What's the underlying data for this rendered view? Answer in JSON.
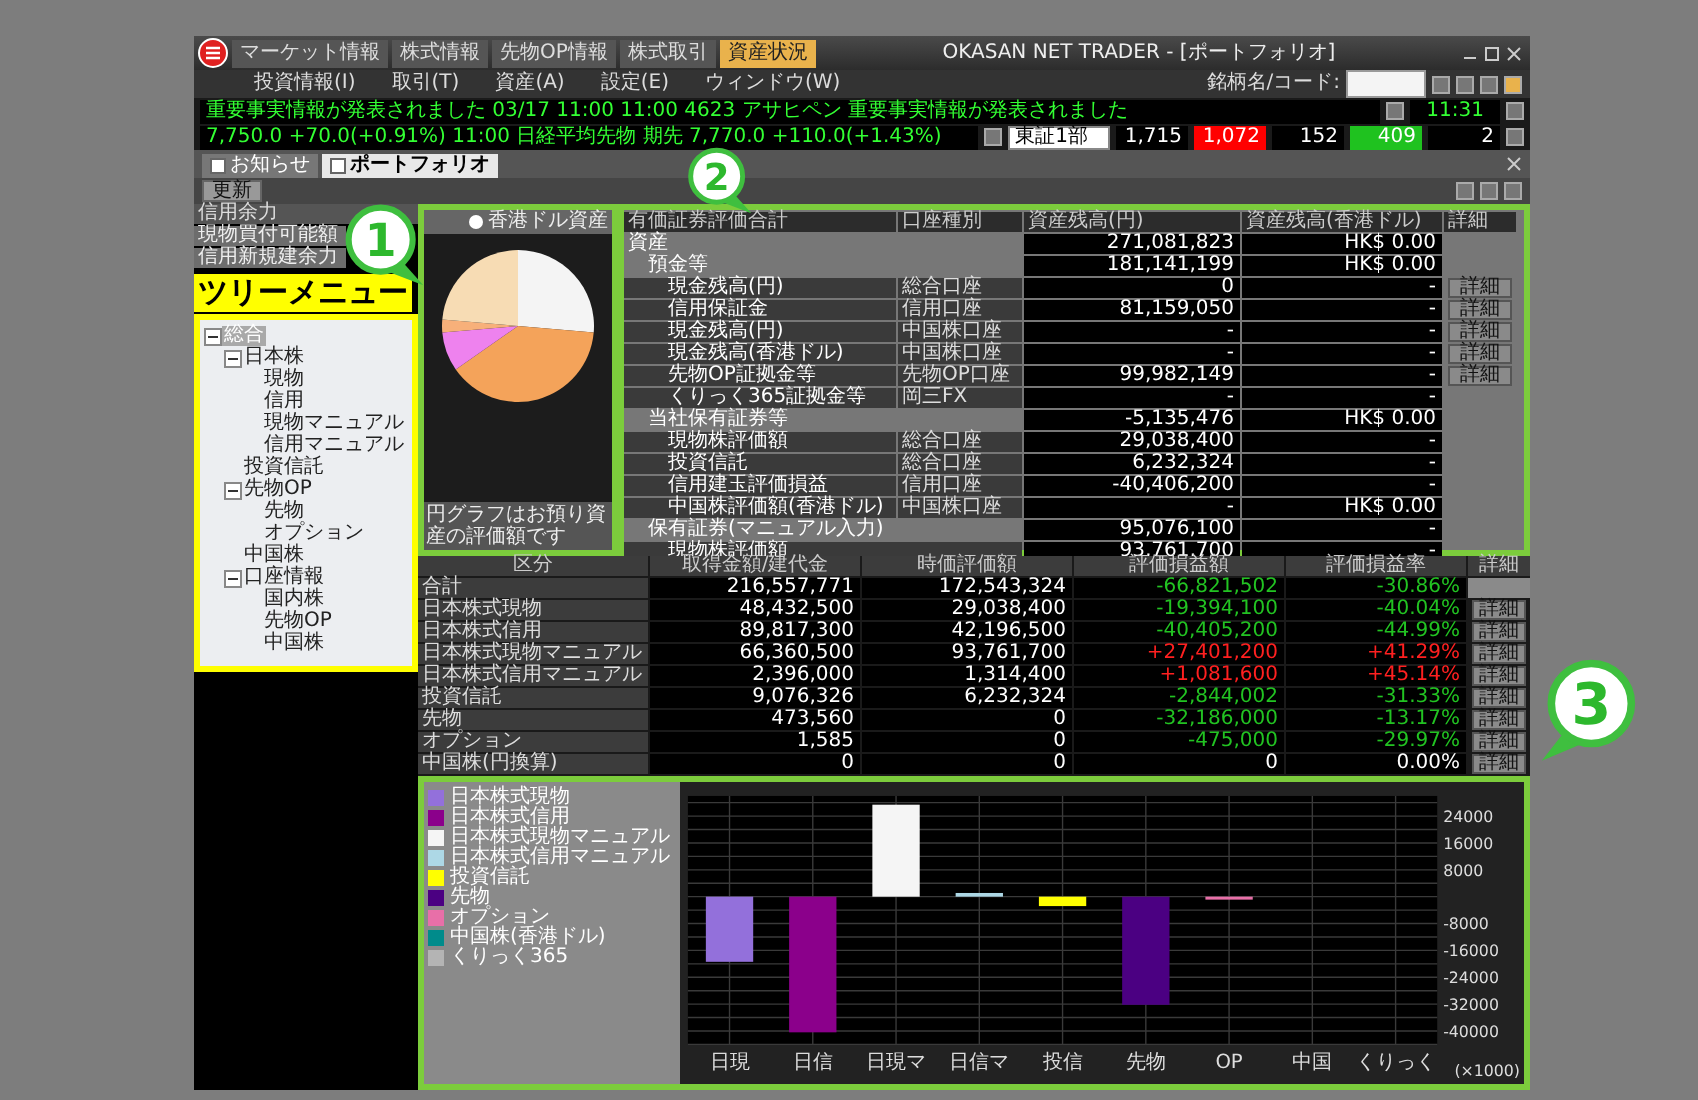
{
  "app": {
    "title": "OKASAN NET TRADER - [ポートフォリオ]"
  },
  "menu_tabs": [
    {
      "label": "マーケット情報",
      "selected": false
    },
    {
      "label": "株式情報",
      "selected": false
    },
    {
      "label": "先物OP情報",
      "selected": false
    },
    {
      "label": "株式取引",
      "selected": false
    },
    {
      "label": "資産状況",
      "selected": true
    }
  ],
  "menu": [
    "投資情報(I)",
    "取引(T)",
    "資産(A)",
    "設定(E)",
    "ウィンドウ(W)"
  ],
  "search": {
    "label": "銘柄名/コード:"
  },
  "tickers": [
    {
      "text": "重要事実情報が発表されました 03/17 11:00 11:00 4623 アサヒペン 重要事実情報が発表されました",
      "time": "11:31"
    },
    {
      "text": "7,750.0 +70.0(+0.91%) 11:00 日経平均先物 期先 7,770.0 +110.0(+1.43%)"
    }
  ],
  "market": {
    "exchange": "東証1部",
    "values": [
      {
        "text": "1,715",
        "color": "#000000"
      },
      {
        "text": "1,072",
        "color": "#ff0000"
      },
      {
        "text": "152",
        "color": "#000000"
      },
      {
        "text": "409",
        "color": "#1fc21f"
      },
      {
        "text": "2",
        "color": "#000000"
      }
    ]
  },
  "doc_tabs": [
    {
      "label": "お知らせ",
      "selected": false
    },
    {
      "label": "ポートフォリオ",
      "selected": true
    }
  ],
  "refresh_button": "更新",
  "credit": {
    "title": "信用余力",
    "rows": [
      "現物買付可能額",
      "信用新規建余力"
    ]
  },
  "tree": {
    "label": "ツリーメニュー",
    "items": [
      {
        "label": "総合",
        "selected": true,
        "expanded": true,
        "children": [
          {
            "label": "日本株",
            "selected": false,
            "expanded": true,
            "children": [
              {
                "label": "現物",
                "selected": false
              },
              {
                "label": "信用",
                "selected": false
              },
              {
                "label": "現物マニュアル",
                "selected": false
              },
              {
                "label": "信用マニュアル",
                "selected": false
              }
            ]
          },
          {
            "label": "投資信託",
            "selected": false
          },
          {
            "label": "先物OP",
            "selected": false,
            "expanded": true,
            "children": [
              {
                "label": "先物",
                "selected": false
              },
              {
                "label": "オプション",
                "selected": false
              }
            ]
          },
          {
            "label": "中国株",
            "selected": false
          },
          {
            "label": "口座情報",
            "selected": false,
            "expanded": true,
            "children": [
              {
                "label": "国内株",
                "selected": false
              },
              {
                "label": "先物OP",
                "selected": false
              },
              {
                "label": "中国株",
                "selected": false
              }
            ]
          }
        ]
      }
    ]
  },
  "pie": {
    "option": {
      "label": "香港ドル資産",
      "selected": false
    },
    "caption": "円グラフはお預り資産の評価額です"
  },
  "assets": {
    "columns": [
      "有価証券評価合計",
      "口座種別",
      "資産残高(円)",
      "資産残高(香港ドル)",
      "詳細"
    ],
    "rows": [
      {
        "label": "資産",
        "yen": "271,081,823",
        "hkd": "HK$ 0.00",
        "children": [
          {
            "label": "預金等",
            "yen": "181,141,199",
            "hkd": "HK$ 0.00",
            "children": [
              {
                "label": "現金残高(円)",
                "account": "総合口座",
                "yen": "0",
                "hkd": "-",
                "detail": "詳細"
              },
              {
                "label": "信用保証金",
                "account": "信用口座",
                "yen": "81,159,050",
                "hkd": "-",
                "detail": "詳細"
              },
              {
                "label": "現金残高(円)",
                "account": "中国株口座",
                "yen": "-",
                "hkd": "-",
                "detail": "詳細"
              },
              {
                "label": "現金残高(香港ドル)",
                "account": "中国株口座",
                "yen": "-",
                "hkd": "-",
                "detail": "詳細"
              },
              {
                "label": "先物OP証拠金等",
                "account": "先物OP口座",
                "yen": "99,982,149",
                "hkd": "-",
                "detail": "詳細"
              },
              {
                "label": "くりっく365証拠金等",
                "account": "岡三FX",
                "yen": "-",
                "hkd": "-"
              }
            ]
          },
          {
            "label": "当社保有証券等",
            "yen": "-5,135,476",
            "hkd": "HK$ 0.00",
            "children": [
              {
                "label": "現物株評価額",
                "account": "総合口座",
                "yen": "29,038,400",
                "hkd": "-"
              },
              {
                "label": "投資信託",
                "account": "総合口座",
                "yen": "6,232,324",
                "hkd": "-"
              },
              {
                "label": "信用建玉評価損益",
                "account": "信用口座",
                "yen": "-40,406,200",
                "hkd": "-"
              },
              {
                "label": "中国株評価額(香港ドル)",
                "account": "中国株口座",
                "yen": "-",
                "hkd": "HK$ 0.00"
              }
            ]
          },
          {
            "label": "保有証券(マニュアル入力)",
            "yen": "95,076,100",
            "hkd": "-",
            "children": [
              {
                "label": "現物株評価額",
                "yen": "93,761,700",
                "hkd": "-"
              }
            ]
          }
        ]
      }
    ]
  },
  "summary": {
    "columns": [
      "区分",
      "取得金額/建代金",
      "時価評価額",
      "評価損益額",
      "評価損益率",
      "詳細"
    ],
    "rows": [
      {
        "label": "合計",
        "cost": "216,557,771",
        "value": "172,543,324",
        "pl": "-66,821,502",
        "rate": "-30.86%",
        "color": "#22c322"
      },
      {
        "label": "日本株式現物",
        "cost": "48,432,500",
        "value": "29,038,400",
        "pl": "-19,394,100",
        "rate": "-40.04%",
        "color": "#22c322",
        "detail": "詳細"
      },
      {
        "label": "日本株式信用",
        "cost": "89,817,300",
        "value": "42,196,500",
        "pl": "-40,405,200",
        "rate": "-44.99%",
        "color": "#22c322",
        "detail": "詳細"
      },
      {
        "label": "日本株式現物マニュアル",
        "cost": "66,360,500",
        "value": "93,761,700",
        "pl": "+27,401,200",
        "rate": "+41.29%",
        "color": "#ff2020",
        "detail": "詳細"
      },
      {
        "label": "日本株式信用マニュアル",
        "cost": "2,396,000",
        "value": "1,314,400",
        "pl": "+1,081,600",
        "rate": "+45.14%",
        "color": "#ff2020",
        "detail": "詳細"
      },
      {
        "label": "投資信託",
        "cost": "9,076,326",
        "value": "6,232,324",
        "pl": "-2,844,002",
        "rate": "-31.33%",
        "color": "#22c322",
        "detail": "詳細"
      },
      {
        "label": "先物",
        "cost": "473,560",
        "value": "0",
        "pl": "-32,186,000",
        "rate": "-13.17%",
        "color": "#22c322",
        "detail": "詳細"
      },
      {
        "label": "オプション",
        "cost": "1,585",
        "value": "0",
        "pl": "-475,000",
        "rate": "-29.97%",
        "color": "#22c322",
        "detail": "詳細"
      },
      {
        "label": "中国株(円換算)",
        "cost": "0",
        "value": "0",
        "pl": "0",
        "rate": "0.00%",
        "color": "#ffffff",
        "detail": "詳細"
      }
    ]
  },
  "chart": {
    "legend": [
      {
        "label": "日本株式現物",
        "color": "#9370db"
      },
      {
        "label": "日本株式信用",
        "color": "#8b008b"
      },
      {
        "label": "日本株式現物マニュアル",
        "color": "#f5f5f5"
      },
      {
        "label": "日本株式信用マニュアル",
        "color": "#add8e6"
      },
      {
        "label": "投資信託",
        "color": "#ffff00"
      },
      {
        "label": "先物",
        "color": "#4b0082"
      },
      {
        "label": "オプション",
        "color": "#e86fa8"
      },
      {
        "label": "中国株(香港ドル)",
        "color": "#008b8b"
      },
      {
        "label": "くりっく365",
        "color": "#b4b4b4"
      }
    ],
    "chart_data": {
      "type": "bar",
      "categories": [
        "日現",
        "日信",
        "日現マ",
        "日信マ",
        "投信",
        "先物",
        "OP",
        "中国",
        "くりっく"
      ],
      "values": [
        -19400,
        -40400,
        27400,
        1100,
        -2800,
        -32200,
        -500,
        0,
        null
      ],
      "ylim": [
        -44000,
        30000
      ],
      "grid": true,
      "yticks": [
        24000,
        16000,
        8000,
        -8000,
        -16000,
        -24000,
        -32000,
        -40000
      ],
      "ylabel": "(×1000)"
    }
  },
  "callouts": [
    {
      "number": "1"
    },
    {
      "number": "2"
    },
    {
      "number": "3"
    }
  ]
}
